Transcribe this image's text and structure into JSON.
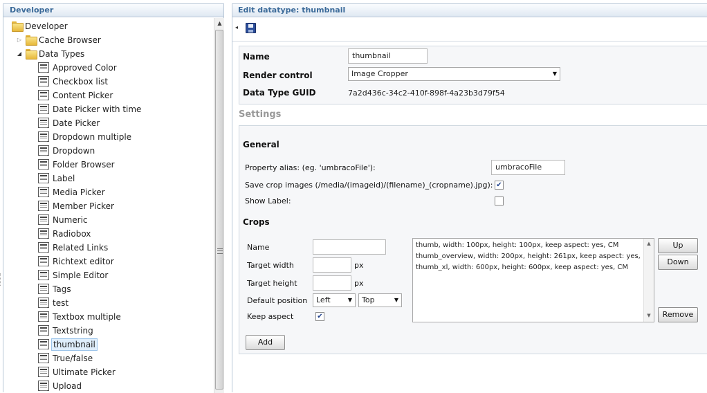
{
  "left_panel": {
    "title": "Developer",
    "tree": {
      "root": "Developer",
      "cache_browser": "Cache Browser",
      "data_types": "Data Types",
      "items": [
        {
          "label": "Approved Color"
        },
        {
          "label": "Checkbox list"
        },
        {
          "label": "Content Picker"
        },
        {
          "label": "Date Picker with time"
        },
        {
          "label": "Date Picker"
        },
        {
          "label": "Dropdown multiple"
        },
        {
          "label": "Dropdown"
        },
        {
          "label": "Folder Browser"
        },
        {
          "label": "Label"
        },
        {
          "label": "Media Picker"
        },
        {
          "label": "Member Picker"
        },
        {
          "label": "Numeric"
        },
        {
          "label": "Radiobox"
        },
        {
          "label": "Related Links"
        },
        {
          "label": "Richtext editor"
        },
        {
          "label": "Simple Editor"
        },
        {
          "label": "Tags"
        },
        {
          "label": "test"
        },
        {
          "label": "Textbox multiple"
        },
        {
          "label": "Textstring"
        },
        {
          "label": "thumbnail",
          "selected": true
        },
        {
          "label": "True/false"
        },
        {
          "label": "Ultimate Picker"
        },
        {
          "label": "Upload"
        }
      ]
    }
  },
  "right_panel": {
    "title": "Edit datatype: thumbnail",
    "props": {
      "name_label": "Name",
      "name_value": "thumbnail",
      "render_label": "Render control",
      "render_value": "Image Cropper",
      "guid_label": "Data Type GUID",
      "guid_value": "7a2d436c-34c2-410f-898f-4a23b3d79f54"
    },
    "settings": {
      "title": "Settings",
      "general_title": "General",
      "alias_label": "Property alias: (eg. 'umbracoFile'):",
      "alias_value": "umbracoFile",
      "save_crop_label": "Save crop images (/media/(imageid)/(filename)_(cropname).jpg):",
      "save_crop_checked": true,
      "show_label_label": "Show Label:",
      "show_label_checked": false,
      "crops_title": "Crops",
      "crop_name_label": "Name",
      "crop_name_value": "",
      "target_width_label": "Target width",
      "target_width_value": "",
      "target_height_label": "Target height",
      "target_height_value": "",
      "px_unit": "px",
      "default_position_label": "Default position",
      "position_h": "Left",
      "position_v": "Top",
      "keep_aspect_label": "Keep aspect",
      "keep_aspect_checked": true,
      "crop_list": [
        "thumb, width: 100px, height: 100px, keep aspect: yes, CM",
        "thumb_overview, width: 200px, height: 261px, keep aspect: yes,",
        "thumb_xl, width: 600px, height: 600px, keep aspect: yes, CM"
      ],
      "up_button": "Up",
      "down_button": "Down",
      "remove_button": "Remove",
      "add_button": "Add"
    }
  }
}
